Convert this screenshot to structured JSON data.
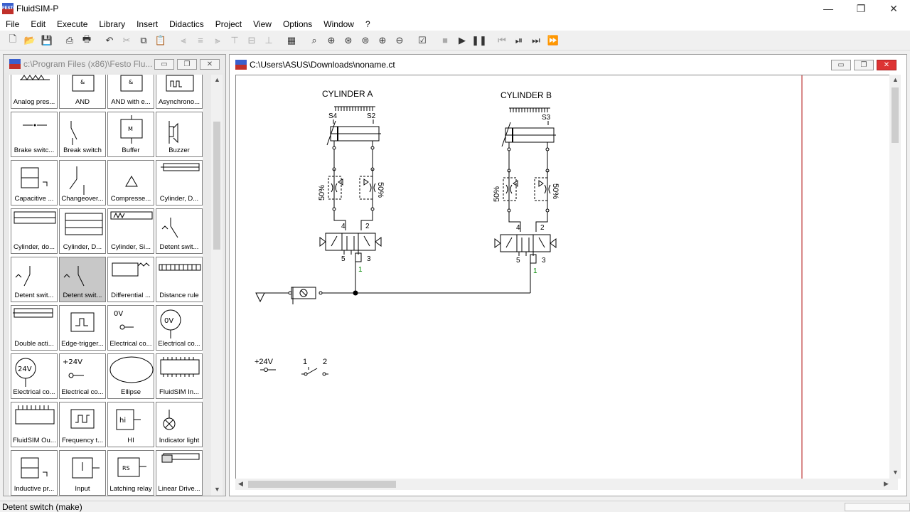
{
  "window": {
    "title": "FluidSIM-P",
    "min": "—",
    "max": "❐",
    "close": "✕"
  },
  "menu": [
    "File",
    "Edit",
    "Execute",
    "Library",
    "Insert",
    "Didactics",
    "Project",
    "View",
    "Options",
    "Window",
    "?"
  ],
  "library_window": {
    "title": "c:\\Program Files (x86)\\Festo Flu...",
    "tiles": [
      [
        "Analog pres...",
        "AND",
        "AND with e...",
        "Asynchrono..."
      ],
      [
        "Brake switc...",
        "Break switch",
        "Buffer",
        "Buzzer"
      ],
      [
        "Capacitive ...",
        "Changeover...",
        "Compresse...",
        "Cylinder, D..."
      ],
      [
        "Cylinder, do...",
        "Cylinder, D...",
        "Cylinder, Si...",
        "Detent swit..."
      ],
      [
        "Detent swit...",
        "Detent swit...",
        "Differential ...",
        "Distance rule"
      ],
      [
        "Double acti...",
        "Edge-trigger...",
        "Electrical co...",
        "Electrical co..."
      ],
      [
        "Electrical co...",
        "Electrical co...",
        "Ellipse",
        "FluidSIM In..."
      ],
      [
        "FluidSIM Ou...",
        "Frequency t...",
        "HI",
        "Indicator light"
      ],
      [
        "Inductive pr...",
        "Input",
        "Latching relay",
        "Linear Drive..."
      ]
    ],
    "selected": [
      4,
      1
    ],
    "tile_text": {
      "buffer": "M",
      "ov1": "0V",
      "ov2": "0V",
      "v24a": "24V",
      "v24b": "+24V",
      "hi": "hi",
      "rs": "RS"
    }
  },
  "diagram_window": {
    "title": "C:\\Users\\ASUS\\Downloads\\noname.ct",
    "labels": {
      "cyl_a": "CYLINDER  A",
      "cyl_b": "CYLINDER  B",
      "s4": "S4",
      "s2": "S2",
      "s3": "S3",
      "pct": "50%",
      "p4": "4",
      "p2": "2",
      "p5": "5",
      "p3": "3",
      "p1": "1",
      "v24": "+24V",
      "sw1": "1",
      "sw2": "2"
    }
  },
  "status": {
    "text": "Detent switch (make)"
  }
}
